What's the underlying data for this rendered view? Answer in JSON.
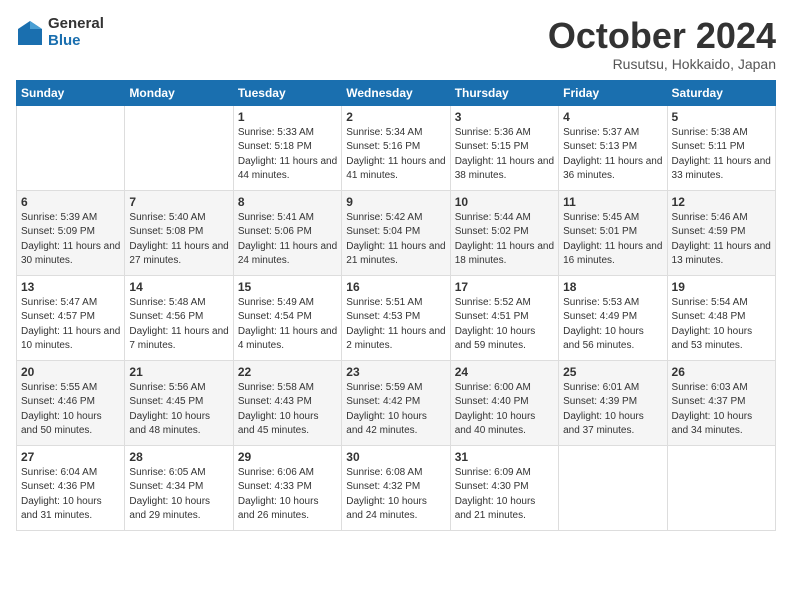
{
  "logo": {
    "general": "General",
    "blue": "Blue"
  },
  "title": "October 2024",
  "location": "Rusutsu, Hokkaido, Japan",
  "days_of_week": [
    "Sunday",
    "Monday",
    "Tuesday",
    "Wednesday",
    "Thursday",
    "Friday",
    "Saturday"
  ],
  "weeks": [
    [
      {
        "day": "",
        "info": ""
      },
      {
        "day": "",
        "info": ""
      },
      {
        "day": "1",
        "info": "Sunrise: 5:33 AM\nSunset: 5:18 PM\nDaylight: 11 hours and 44 minutes."
      },
      {
        "day": "2",
        "info": "Sunrise: 5:34 AM\nSunset: 5:16 PM\nDaylight: 11 hours and 41 minutes."
      },
      {
        "day": "3",
        "info": "Sunrise: 5:36 AM\nSunset: 5:15 PM\nDaylight: 11 hours and 38 minutes."
      },
      {
        "day": "4",
        "info": "Sunrise: 5:37 AM\nSunset: 5:13 PM\nDaylight: 11 hours and 36 minutes."
      },
      {
        "day": "5",
        "info": "Sunrise: 5:38 AM\nSunset: 5:11 PM\nDaylight: 11 hours and 33 minutes."
      }
    ],
    [
      {
        "day": "6",
        "info": "Sunrise: 5:39 AM\nSunset: 5:09 PM\nDaylight: 11 hours and 30 minutes."
      },
      {
        "day": "7",
        "info": "Sunrise: 5:40 AM\nSunset: 5:08 PM\nDaylight: 11 hours and 27 minutes."
      },
      {
        "day": "8",
        "info": "Sunrise: 5:41 AM\nSunset: 5:06 PM\nDaylight: 11 hours and 24 minutes."
      },
      {
        "day": "9",
        "info": "Sunrise: 5:42 AM\nSunset: 5:04 PM\nDaylight: 11 hours and 21 minutes."
      },
      {
        "day": "10",
        "info": "Sunrise: 5:44 AM\nSunset: 5:02 PM\nDaylight: 11 hours and 18 minutes."
      },
      {
        "day": "11",
        "info": "Sunrise: 5:45 AM\nSunset: 5:01 PM\nDaylight: 11 hours and 16 minutes."
      },
      {
        "day": "12",
        "info": "Sunrise: 5:46 AM\nSunset: 4:59 PM\nDaylight: 11 hours and 13 minutes."
      }
    ],
    [
      {
        "day": "13",
        "info": "Sunrise: 5:47 AM\nSunset: 4:57 PM\nDaylight: 11 hours and 10 minutes."
      },
      {
        "day": "14",
        "info": "Sunrise: 5:48 AM\nSunset: 4:56 PM\nDaylight: 11 hours and 7 minutes."
      },
      {
        "day": "15",
        "info": "Sunrise: 5:49 AM\nSunset: 4:54 PM\nDaylight: 11 hours and 4 minutes."
      },
      {
        "day": "16",
        "info": "Sunrise: 5:51 AM\nSunset: 4:53 PM\nDaylight: 11 hours and 2 minutes."
      },
      {
        "day": "17",
        "info": "Sunrise: 5:52 AM\nSunset: 4:51 PM\nDaylight: 10 hours and 59 minutes."
      },
      {
        "day": "18",
        "info": "Sunrise: 5:53 AM\nSunset: 4:49 PM\nDaylight: 10 hours and 56 minutes."
      },
      {
        "day": "19",
        "info": "Sunrise: 5:54 AM\nSunset: 4:48 PM\nDaylight: 10 hours and 53 minutes."
      }
    ],
    [
      {
        "day": "20",
        "info": "Sunrise: 5:55 AM\nSunset: 4:46 PM\nDaylight: 10 hours and 50 minutes."
      },
      {
        "day": "21",
        "info": "Sunrise: 5:56 AM\nSunset: 4:45 PM\nDaylight: 10 hours and 48 minutes."
      },
      {
        "day": "22",
        "info": "Sunrise: 5:58 AM\nSunset: 4:43 PM\nDaylight: 10 hours and 45 minutes."
      },
      {
        "day": "23",
        "info": "Sunrise: 5:59 AM\nSunset: 4:42 PM\nDaylight: 10 hours and 42 minutes."
      },
      {
        "day": "24",
        "info": "Sunrise: 6:00 AM\nSunset: 4:40 PM\nDaylight: 10 hours and 40 minutes."
      },
      {
        "day": "25",
        "info": "Sunrise: 6:01 AM\nSunset: 4:39 PM\nDaylight: 10 hours and 37 minutes."
      },
      {
        "day": "26",
        "info": "Sunrise: 6:03 AM\nSunset: 4:37 PM\nDaylight: 10 hours and 34 minutes."
      }
    ],
    [
      {
        "day": "27",
        "info": "Sunrise: 6:04 AM\nSunset: 4:36 PM\nDaylight: 10 hours and 31 minutes."
      },
      {
        "day": "28",
        "info": "Sunrise: 6:05 AM\nSunset: 4:34 PM\nDaylight: 10 hours and 29 minutes."
      },
      {
        "day": "29",
        "info": "Sunrise: 6:06 AM\nSunset: 4:33 PM\nDaylight: 10 hours and 26 minutes."
      },
      {
        "day": "30",
        "info": "Sunrise: 6:08 AM\nSunset: 4:32 PM\nDaylight: 10 hours and 24 minutes."
      },
      {
        "day": "31",
        "info": "Sunrise: 6:09 AM\nSunset: 4:30 PM\nDaylight: 10 hours and 21 minutes."
      },
      {
        "day": "",
        "info": ""
      },
      {
        "day": "",
        "info": ""
      }
    ]
  ]
}
